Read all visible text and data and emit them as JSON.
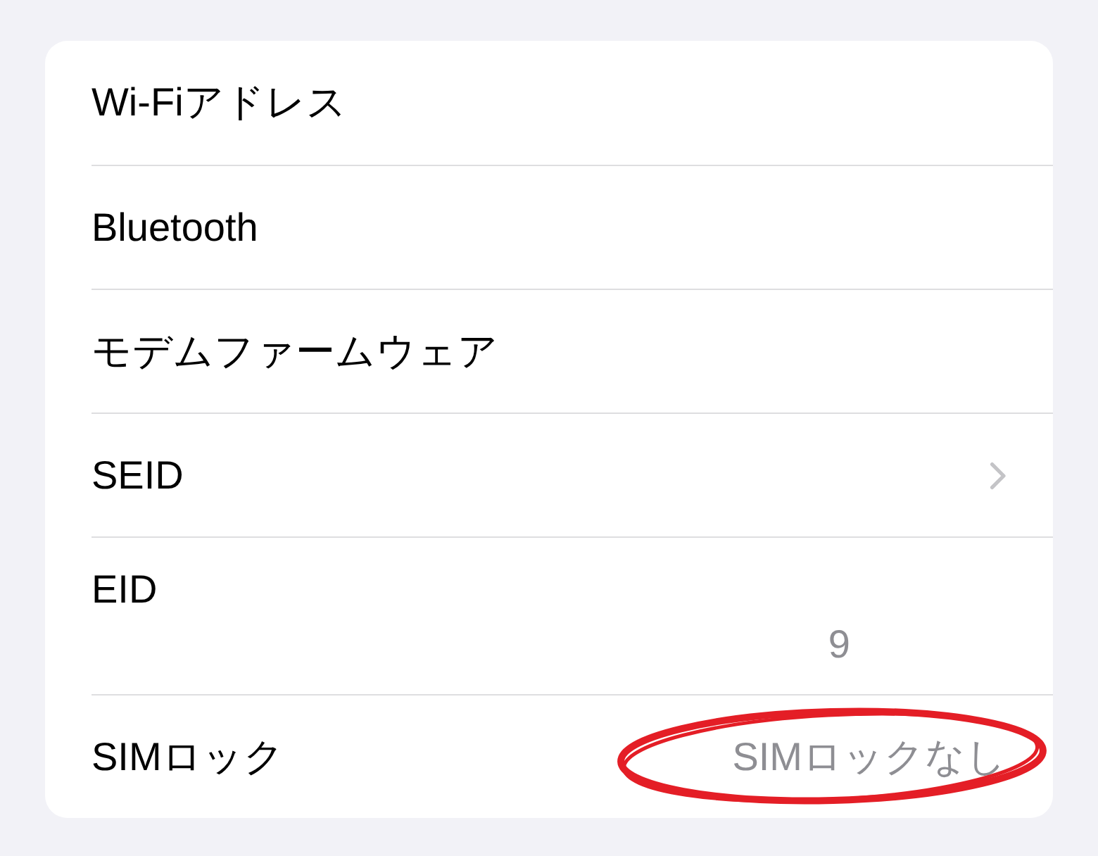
{
  "settings_list": {
    "rows": [
      {
        "kind": "plain",
        "label": "Wi-Fiアドレス",
        "circled": false
      },
      {
        "kind": "plain",
        "label": "Bluetooth",
        "circled": false
      },
      {
        "kind": "plain",
        "label": "モデムファームウェア",
        "circled": false
      },
      {
        "kind": "link",
        "label": "SEID",
        "circled": false
      },
      {
        "kind": "stacked",
        "label": "EID",
        "value": "9",
        "circled": false
      },
      {
        "kind": "value",
        "label": "SIMロック",
        "value": "SIMロックなし",
        "circled": true
      }
    ]
  }
}
